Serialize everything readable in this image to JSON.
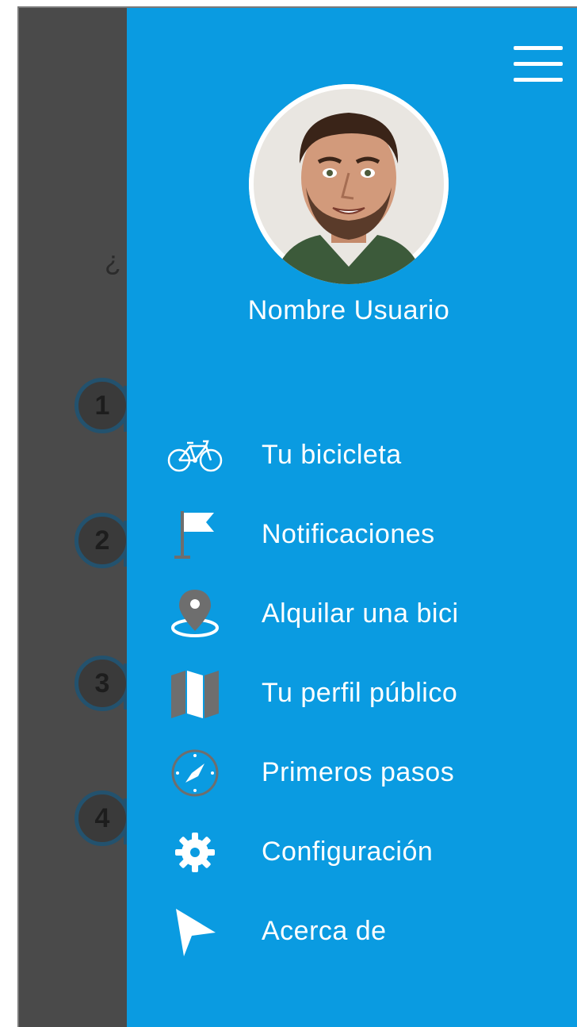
{
  "background": {
    "question_fragment": "¿",
    "steps": [
      "1",
      "2",
      "3",
      "4"
    ]
  },
  "drawer": {
    "menu_button": "menu-icon",
    "user_name": "Nombre Usuario",
    "items": [
      {
        "label": "Tu bicicleta",
        "icon": "bicycle-icon"
      },
      {
        "label": "Notificaciones",
        "icon": "flag-icon"
      },
      {
        "label": "Alquilar una bici",
        "icon": "location-pin-icon"
      },
      {
        "label": "Tu perfil público",
        "icon": "map-icon"
      },
      {
        "label": "Primeros pasos",
        "icon": "compass-icon"
      },
      {
        "label": "Configuración",
        "icon": "gear-icon"
      },
      {
        "label": "Acerca de",
        "icon": "pointer-arrow-icon"
      }
    ]
  },
  "colors": {
    "drawer_bg": "#0a9be1",
    "overlay": "#4a4a4a",
    "icon_gray": "#6e6e6e",
    "text": "#ffffff"
  }
}
